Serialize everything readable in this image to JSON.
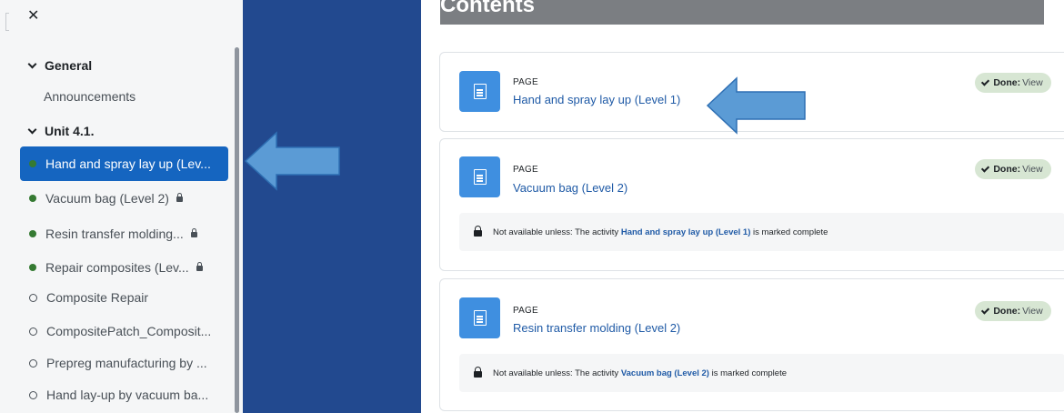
{
  "drawer": {
    "close_icon": "close-icon",
    "sections": [
      {
        "label": "General"
      },
      {
        "label": "Unit 4.1."
      }
    ],
    "general_items": [
      {
        "label": "Announcements"
      }
    ],
    "unit_items": [
      {
        "label": "Hand and spray lay up (Lev...",
        "status": "complete",
        "active": true,
        "locked": false
      },
      {
        "label": "Vacuum bag (Level 2)",
        "status": "complete",
        "active": false,
        "locked": true
      },
      {
        "label": "Resin transfer molding...",
        "status": "complete",
        "active": false,
        "locked": true
      },
      {
        "label": "Repair composites (Lev...",
        "status": "complete",
        "active": false,
        "locked": true
      },
      {
        "label": "Composite Repair",
        "status": "incomplete",
        "active": false,
        "locked": false
      },
      {
        "label": "CompositePatch_Composit...",
        "status": "incomplete",
        "active": false,
        "locked": false
      },
      {
        "label": "Prepreg manufacturing by ...",
        "status": "incomplete",
        "active": false,
        "locked": false
      },
      {
        "label": "Hand lay-up by vacuum ba...",
        "status": "incomplete",
        "active": false,
        "locked": false
      }
    ]
  },
  "main": {
    "title": "Contents",
    "activities": [
      {
        "type": "PAGE",
        "name": "Hand and spray lay up (Level 1)",
        "done_label": "Done:",
        "done_value": "View"
      },
      {
        "type": "PAGE",
        "name": "Vacuum bag (Level 2)",
        "done_label": "Done:",
        "done_value": "View",
        "restriction": {
          "prefix": "Not available unless: The activity",
          "activity": "Hand and spray lay up (Level 1)",
          "suffix": "is marked complete"
        }
      },
      {
        "type": "PAGE",
        "name": "Resin transfer molding (Level 2)",
        "done_label": "Done:",
        "done_value": "View",
        "restriction": {
          "prefix": "Not available unless: The activity",
          "activity": "Vacuum bag (Level 2)",
          "suffix": "is marked complete"
        }
      }
    ]
  },
  "colors": {
    "active_item": "#1565c0",
    "sidebar_bg": "#f5f6f7",
    "blue_band": "#22498f",
    "activity_icon": "#3f8fe0",
    "done_badge": "#d7e6d3",
    "link": "#1f5aa6",
    "annotation_arrow": "#5b9bd5"
  }
}
